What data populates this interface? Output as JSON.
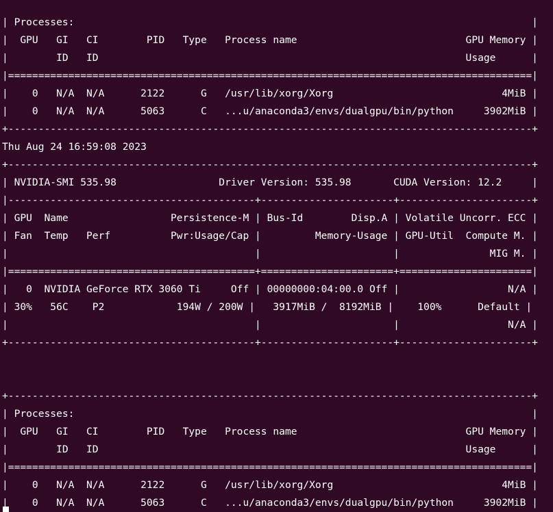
{
  "terminal": {
    "lines": [
      "| Processes:                                                                            |",
      "|  GPU   GI   CI        PID   Type   Process name                            GPU Memory |",
      "|        ID   ID                                                             Usage      |",
      "|=======================================================================================|",
      "|    0   N/A  N/A      2122      G   /usr/lib/xorg/Xorg                            4MiB |",
      "|    0   N/A  N/A      5063      C   ...u/anaconda3/envs/dualgpu/bin/python     3902MiB |",
      "+---------------------------------------------------------------------------------------+",
      "Thu Aug 24 16:59:08 2023",
      "+---------------------------------------------------------------------------------------+",
      "| NVIDIA-SMI 535.98                 Driver Version: 535.98       CUDA Version: 12.2     |",
      "|-----------------------------------------+----------------------+----------------------+",
      "| GPU  Name                 Persistence-M | Bus-Id        Disp.A | Volatile Uncorr. ECC |",
      "| Fan  Temp   Perf          Pwr:Usage/Cap |         Memory-Usage | GPU-Util  Compute M. |",
      "|                                         |                      |               MIG M. |",
      "|=========================================+======================+======================|",
      "|   0  NVIDIA GeForce RTX 3060 Ti     Off | 00000000:04:00.0 Off |                  N/A |",
      "| 30%   56C    P2            194W / 200W |   3917MiB /  8192MiB |    100%      Default |",
      "|                                         |                      |                  N/A |",
      "+-----------------------------------------+----------------------+----------------------+",
      "",
      "",
      "+---------------------------------------------------------------------------------------+",
      "| Processes:                                                                            |",
      "|  GPU   GI   CI        PID   Type   Process name                            GPU Memory |",
      "|        ID   ID                                                             Usage      |",
      "|=======================================================================================|",
      "|    0   N/A  N/A      2122      G   /usr/lib/xorg/Xorg                            4MiB |",
      "|    0   N/A  N/A      5063      C   ...u/anaconda3/envs/dualgpu/bin/python     3902MiB |"
    ]
  },
  "colors": {
    "background": "#300a24",
    "foreground": "#ffffff"
  }
}
